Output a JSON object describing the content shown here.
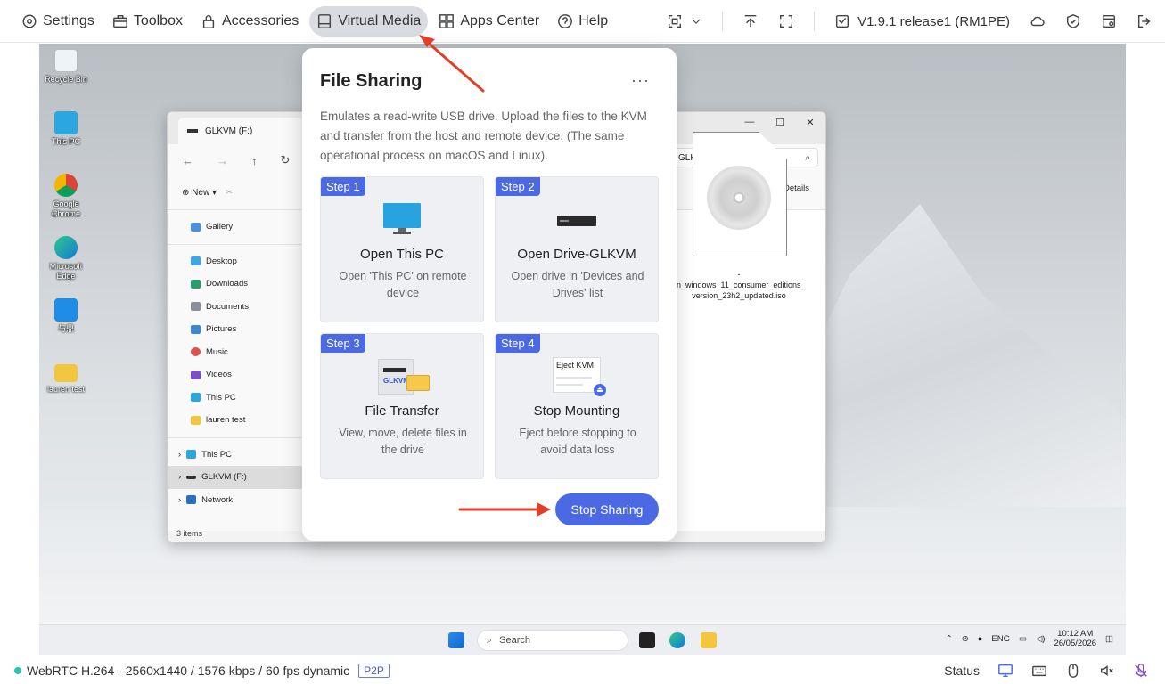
{
  "topbar": {
    "menu": [
      {
        "label": "Settings",
        "icon": "gear-icon"
      },
      {
        "label": "Toolbox",
        "icon": "toolbox-icon"
      },
      {
        "label": "Accessories",
        "icon": "lock-icon"
      },
      {
        "label": "Virtual Media",
        "icon": "drive-icon",
        "active": true
      },
      {
        "label": "Apps Center",
        "icon": "apps-icon"
      },
      {
        "label": "Help",
        "icon": "help-icon"
      }
    ],
    "version": "V1.9.1 release1 (RM1PE)"
  },
  "remote": {
    "desktop_icons": [
      "Recycle Bin",
      "This PC",
      "Google Chrome",
      "Microsoft Edge",
      "与鼎",
      "lauren test"
    ],
    "explorer": {
      "tab_title": "GLKVM (F:)",
      "address": "GLKVM (F:)",
      "new_label": "New",
      "details_label": "Details",
      "sidebar": [
        "Gallery",
        "Desktop",
        "Downloads",
        "Documents",
        "Pictures",
        "Music",
        "Videos",
        "This PC",
        "lauren test"
      ],
      "tree": [
        "This PC",
        "GLKVM (F:)",
        "Network"
      ],
      "file_name": "-cn_windows_11_consumer_editions_ version_23h2_updated.iso",
      "status": "3 items"
    },
    "taskbar": {
      "search": "Search",
      "lang": "ENG",
      "time": "10:12 AM",
      "date": "26/05/2026"
    }
  },
  "panel": {
    "title": "File Sharing",
    "more": "···",
    "description": "Emulates a read-write USB drive. Upload the files to the KVM and transfer from the host and remote device. (The same operational process on macOS and Linux).",
    "steps": [
      {
        "badge": "Step 1",
        "title": "Open This PC",
        "desc": "Open 'This PC' on remote device"
      },
      {
        "badge": "Step 2",
        "title": "Open Drive-GLKVM",
        "desc": "Open drive in 'Devices and Drives' list"
      },
      {
        "badge": "Step 3",
        "title": "File Transfer",
        "desc": "View, move, delete files in the drive",
        "image_text": "GLKVM"
      },
      {
        "badge": "Step 4",
        "title": "Stop Mounting",
        "desc": "Eject before stopping to avoid data loss",
        "image_text": "Eject KVM"
      }
    ],
    "stop_button": "Stop Sharing"
  },
  "statusbar": {
    "stream": "WebRTC H.264 - 2560x1440 / 1576 kbps / 60 fps dynamic",
    "badge": "P2P",
    "status_label": "Status"
  },
  "colors": {
    "accent": "#4a69e2",
    "arrow": "#e0402a",
    "online": "#2cc4a8"
  }
}
